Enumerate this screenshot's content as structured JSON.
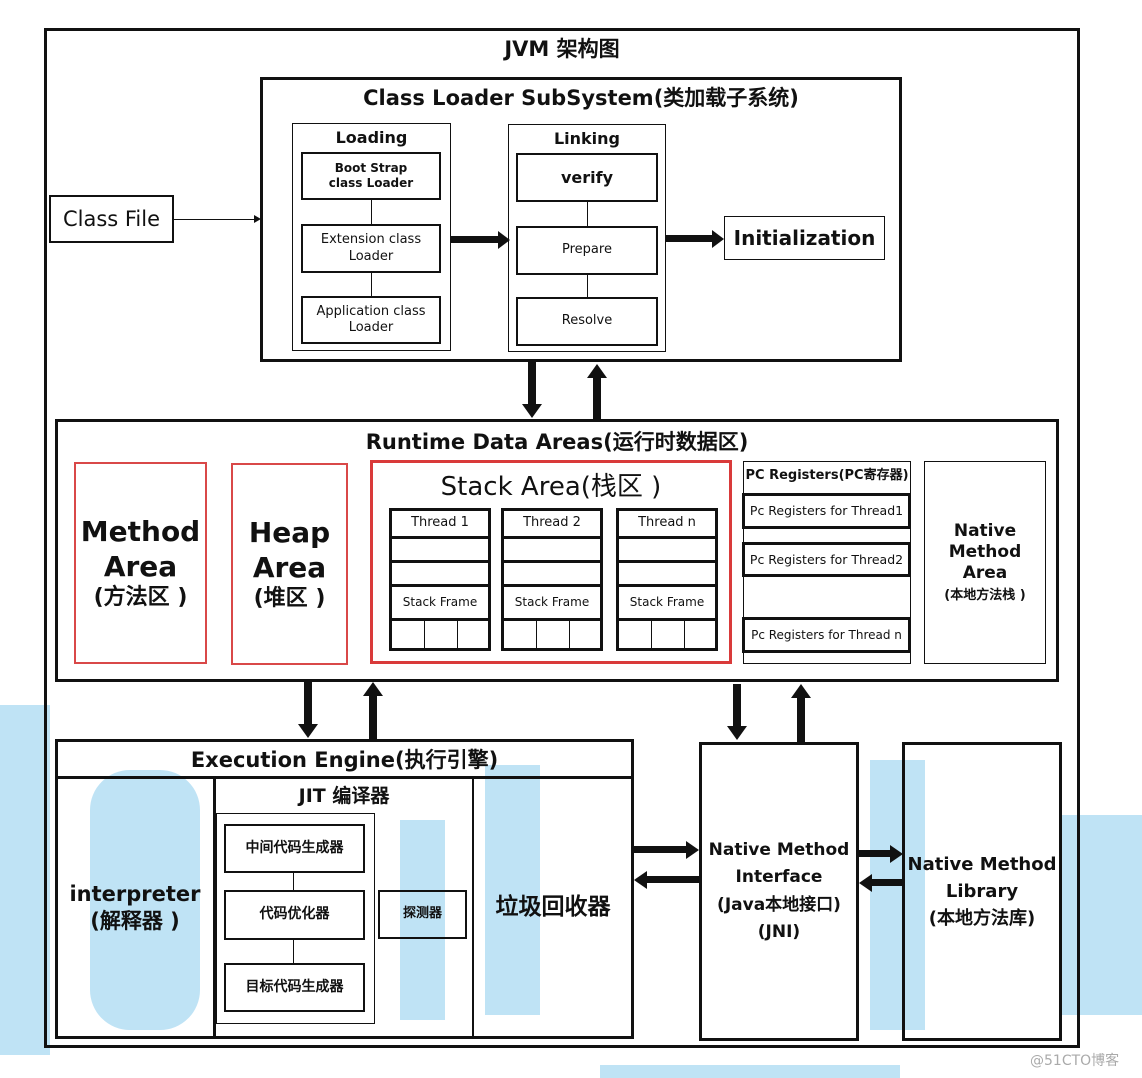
{
  "title": "JVM 架构图",
  "class_file": "Class File",
  "class_loader": {
    "title": "Class Loader SubSystem(类加载子系统)",
    "loading": {
      "title": "Loading",
      "items": [
        "Boot Strap\nclass Loader",
        "Extension class\nLoader",
        "Application class\nLoader"
      ]
    },
    "linking": {
      "title": "Linking",
      "items": [
        "verify",
        "Prepare",
        "Resolve"
      ]
    },
    "initialization": "Initialization"
  },
  "runtime": {
    "title": "Runtime Data Areas(运行时数据区)",
    "method_area": [
      "Method",
      "Area",
      "(方法区 )"
    ],
    "heap_area": [
      "Heap",
      "Area",
      "(堆区 )"
    ],
    "stack_area": {
      "title": "Stack Area(栈区 )",
      "threads": [
        "Thread 1",
        "Thread 2",
        "Thread n"
      ],
      "frame": "Stack Frame"
    },
    "pc": {
      "title": "PC Registers(PC寄存器)",
      "items": [
        "Pc Registers for Thread1",
        "Pc Registers for Thread2",
        "Pc Registers for Thread n"
      ]
    },
    "native_area": [
      "Native",
      "Method",
      "Area",
      "(本地方法栈 )"
    ]
  },
  "engine": {
    "title": "Execution Engine(执行引擎)",
    "interpreter": [
      "interpreter",
      "(解释器 )"
    ],
    "jit": {
      "title": "JIT 编译器",
      "items": [
        "中间代码生成器",
        "代码优化器",
        "目标代码生成器"
      ],
      "probe": "探测器"
    },
    "gc": "垃圾回收器"
  },
  "jni": [
    "Native Method",
    "Interface",
    "(Java本地接口)",
    "(JNI)"
  ],
  "library": [
    "Native Method",
    "Library",
    "(本地方法库)"
  ],
  "watermark": "@51CTO博客",
  "colors": {
    "highlight": "#e03a3a",
    "watermark": "#bfe3f5"
  }
}
